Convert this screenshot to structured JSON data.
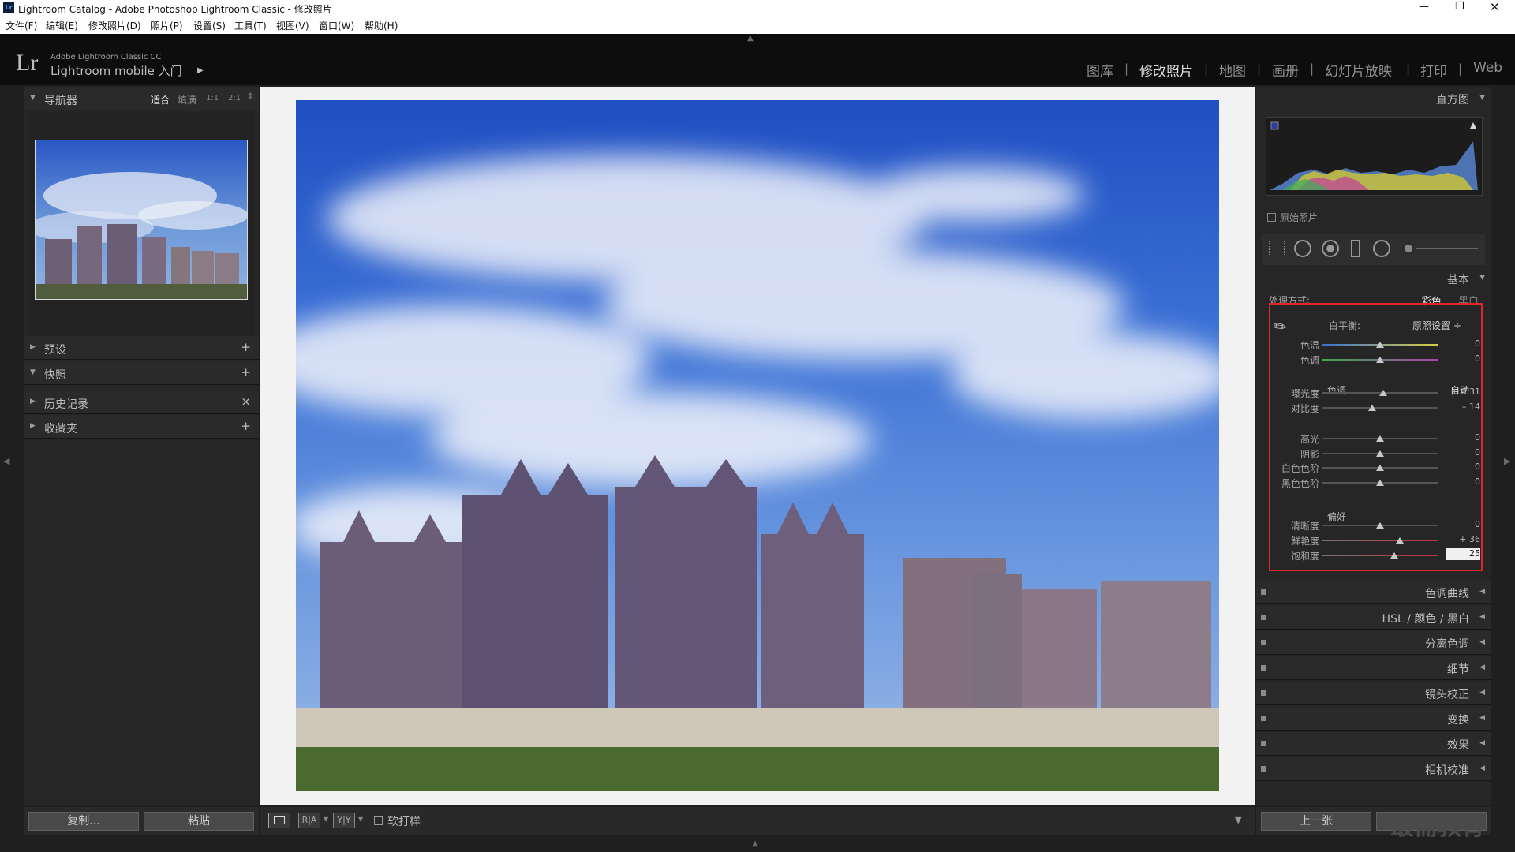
{
  "window": {
    "title": "Lightroom Catalog - Adobe Photoshop Lightroom Classic - 修改照片",
    "app_icon": "Lr"
  },
  "menu": [
    "文件(F)",
    "编辑(E)",
    "修改照片(D)",
    "照片(P)",
    "设置(S)",
    "工具(T)",
    "视图(V)",
    "窗口(W)",
    "帮助(H)"
  ],
  "identity": {
    "logo": "Lr",
    "product": "Adobe Lightroom Classic CC",
    "mobile": "Lightroom mobile 入门",
    "modules": [
      "图库",
      "修改照片",
      "地图",
      "画册",
      "幻灯片放映",
      "打印",
      "Web"
    ],
    "active_module": "修改照片"
  },
  "left": {
    "navigator": {
      "label": "导航器",
      "zoom": [
        "适合",
        "填满",
        "1:1",
        "2:1"
      ]
    },
    "panels": [
      {
        "label": "预设",
        "action": "+"
      },
      {
        "label": "快照",
        "action": "+"
      },
      {
        "label": "历史记录",
        "action": "×"
      },
      {
        "label": "收藏夹",
        "action": "+"
      }
    ],
    "copy_button": "复制...",
    "paste_button": "粘贴"
  },
  "right": {
    "histogram_label": "直方图",
    "original_photo": "原始照片",
    "basic_label": "基本",
    "treatment": {
      "label": "处理方式:",
      "color": "彩色",
      "bw": "黑白"
    },
    "wb": {
      "label": "白平衡:",
      "value": "原照设置 ÷"
    },
    "tone": {
      "label": "色调",
      "auto": "自动"
    },
    "presence": "偏好",
    "sliders": [
      {
        "label": "色温",
        "value": "0",
        "pos": 0.5
      },
      {
        "label": "色调",
        "value": "0",
        "pos": 0.5
      },
      {
        "label": "曝光度",
        "value": "+ 0.31",
        "pos": 0.53
      },
      {
        "label": "对比度",
        "value": "– 14",
        "pos": 0.43
      },
      {
        "label": "高光",
        "value": "0",
        "pos": 0.5
      },
      {
        "label": "阴影",
        "value": "0",
        "pos": 0.5
      },
      {
        "label": "白色色阶",
        "value": "0",
        "pos": 0.5
      },
      {
        "label": "黑色色阶",
        "value": "0",
        "pos": 0.5
      },
      {
        "label": "清晰度",
        "value": "0",
        "pos": 0.5
      },
      {
        "label": "鲜艳度",
        "value": "+ 36",
        "pos": 0.67
      },
      {
        "label": "饱和度",
        "value": "25",
        "pos": 0.62
      }
    ],
    "sections": [
      "色调曲线",
      "HSL / 颜色 / 黑白",
      "分离色调",
      "细节",
      "镜头校正",
      "变换",
      "效果",
      "相机校准"
    ],
    "prev_button": "上一张",
    "watermark": "最需教育"
  },
  "toolbar": {
    "view_buttons": [
      "R|A",
      "Y|Y"
    ],
    "soft_proof": "软打样"
  }
}
